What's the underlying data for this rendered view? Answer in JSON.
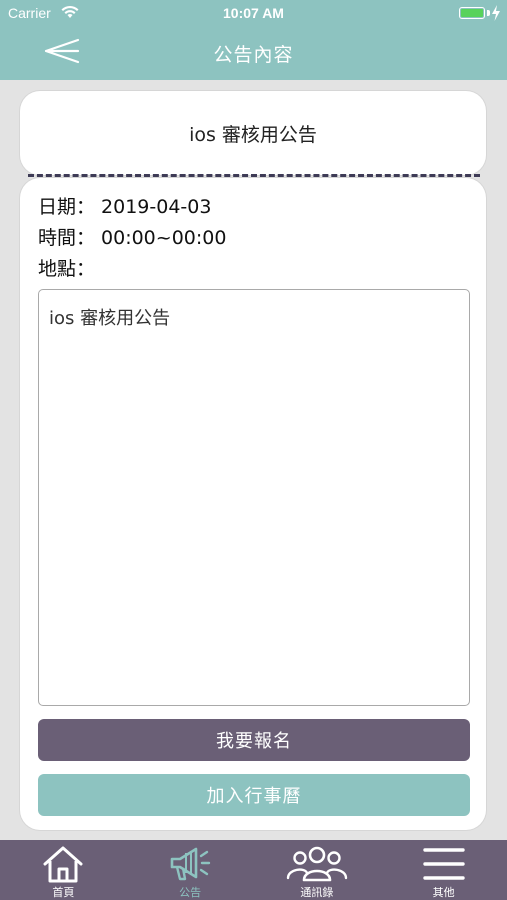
{
  "status_bar": {
    "carrier": "Carrier",
    "time": "10:07 AM"
  },
  "nav": {
    "title": "公告內容",
    "back_icon": "paper-plane-back-icon"
  },
  "announcement": {
    "title": "ios 審核用公告",
    "date_label": "日期：",
    "date_value": "2019-04-03",
    "time_label": "時間：",
    "time_value": "00:00~00:00",
    "place_label": "地點：",
    "place_value": "",
    "content": "ios 審核用公告"
  },
  "buttons": {
    "signup": "我要報名",
    "add_calendar": "加入行事曆"
  },
  "tabs": [
    {
      "label": "首頁",
      "icon": "home-icon",
      "active": false
    },
    {
      "label": "公告",
      "icon": "megaphone-icon",
      "active": true
    },
    {
      "label": "通訊錄",
      "icon": "contacts-icon",
      "active": false
    },
    {
      "label": "其他",
      "icon": "menu-icon",
      "active": false
    }
  ],
  "colors": {
    "primary_teal": "#8dc3c0",
    "primary_purple": "#6a5f76",
    "dash": "#3e3b56",
    "battery_green": "#58d25c"
  }
}
